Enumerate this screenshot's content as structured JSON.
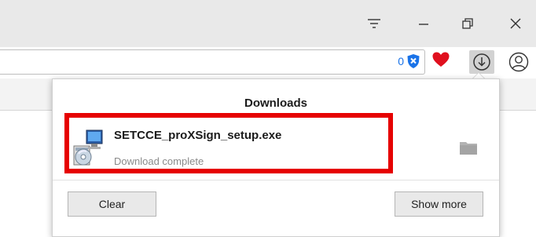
{
  "window": {
    "controls": [
      {
        "icon": "overflow-menu-icon"
      },
      {
        "icon": "minimize-icon"
      },
      {
        "icon": "restore-icon"
      },
      {
        "icon": "close-icon"
      }
    ]
  },
  "toolbar": {
    "blocked_count": "0",
    "icons": [
      "shield-icon",
      "heart-icon",
      "download-icon",
      "profile-icon"
    ]
  },
  "downloads": {
    "title": "Downloads",
    "items": [
      {
        "filename": "SETCCE_proXSign_setup.exe",
        "status": "Download complete",
        "icon": "installer-icon"
      }
    ],
    "clear_label": "Clear",
    "show_more_label": "Show more"
  },
  "colors": {
    "highlight": "#e60000",
    "heart": "#e0101e",
    "shield": "#1a73e8"
  }
}
